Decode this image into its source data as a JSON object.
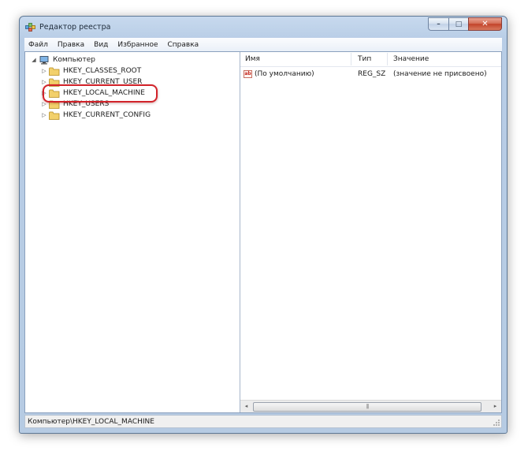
{
  "window": {
    "title": "Редактор реестра",
    "caption_buttons": {
      "minimize": "–",
      "maximize": "□",
      "close": "✕"
    }
  },
  "menu": [
    {
      "label": "Файл"
    },
    {
      "label": "Правка"
    },
    {
      "label": "Вид"
    },
    {
      "label": "Избранное"
    },
    {
      "label": "Справка"
    }
  ],
  "tree": {
    "root": {
      "label": "Компьютер",
      "expander": "◢"
    },
    "items": [
      {
        "label": "HKEY_CLASSES_ROOT",
        "expander": "▷"
      },
      {
        "label": "HKEY_CURRENT_USER",
        "expander": "▷"
      },
      {
        "label": "HKEY_LOCAL_MACHINE",
        "expander": "▷"
      },
      {
        "label": "HKEY_USERS",
        "expander": "▷"
      },
      {
        "label": "HKEY_CURRENT_CONFIG",
        "expander": "▷"
      }
    ]
  },
  "list": {
    "columns": {
      "name": "Имя",
      "type": "Тип",
      "value": "Значение"
    },
    "rows": [
      {
        "icon": "ab",
        "name": "(По умолчанию)",
        "type": "REG_SZ",
        "value": "(значение не присвоено)"
      }
    ]
  },
  "scroll": {
    "left_arrow": "◂",
    "right_arrow": "▸",
    "grip": "|||"
  },
  "status": {
    "path": "Компьютер\\HKEY_LOCAL_MACHINE"
  },
  "colors": {
    "highlight_ring": "#d2232a",
    "folder": "#f2d06b"
  }
}
